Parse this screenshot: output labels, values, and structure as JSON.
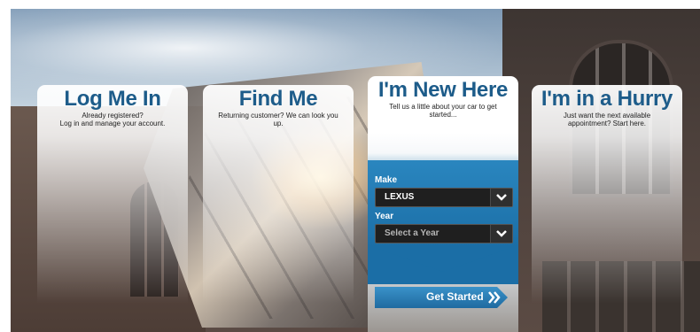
{
  "cards": {
    "login": {
      "title": "Log Me In",
      "desc1": "Already registered?",
      "desc2": "Log in and manage your account."
    },
    "find": {
      "title": "Find Me",
      "desc1": "Returning customer? We can look you",
      "desc2": "up."
    },
    "new": {
      "title": "I'm New Here",
      "desc1": "Tell us a little about your car to get",
      "desc2": "started..."
    },
    "hurry": {
      "title": "I'm in a Hurry",
      "desc1": "Just want the next available",
      "desc2": "appointment? Start here."
    }
  },
  "form": {
    "make_label": "Make",
    "make_value": "LEXUS",
    "year_label": "Year",
    "year_placeholder": "Select a Year",
    "submit_label": "Get Started"
  },
  "icons": {
    "make_dropdown": "chevron-down-icon",
    "year_dropdown": "chevron-down-icon",
    "submit": "double-chevron-right-icon"
  },
  "colors": {
    "title": "#1d5c8a",
    "panel_blue": "#1b6ea6",
    "select_bg": "#1f1f1f"
  }
}
